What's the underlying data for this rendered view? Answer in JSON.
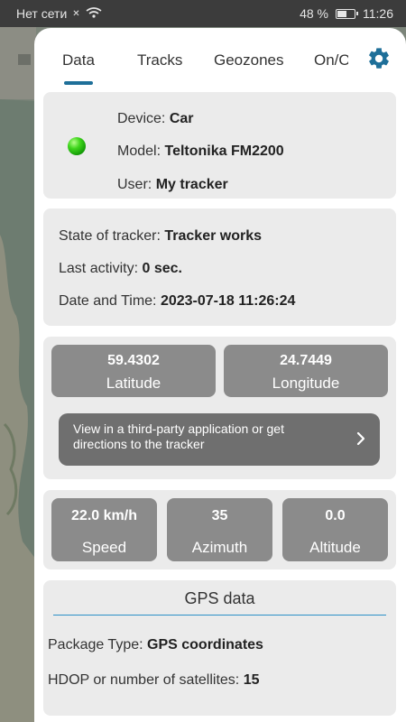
{
  "status_bar": {
    "carrier": "Нет сети",
    "battery": "48 %",
    "battery_level": 0.48,
    "time": "11:26"
  },
  "tabs": [
    {
      "label": "Data",
      "active": true
    },
    {
      "label": "Tracks",
      "active": false
    },
    {
      "label": "Geozones",
      "active": false
    },
    {
      "label": "On/O",
      "active": false
    }
  ],
  "icons": {
    "settings": "gear-icon",
    "direction": "chevron-right-icon",
    "status": "green-status-dot-icon"
  },
  "colors": {
    "accent": "#1e6f99",
    "card_bg": "#ebebeb",
    "tile_bg": "#8b8b8b",
    "status_green": "#2ec21b"
  },
  "device_card": {
    "device_label": "Device:",
    "device_value": "Car",
    "model_label": "Model:",
    "model_value": "Teltonika FM2200",
    "user_label": "User:",
    "user_value": "My tracker"
  },
  "state_card": {
    "state_label": "State of tracker:",
    "state_value": "Tracker works",
    "activity_label": "Last activity:",
    "activity_value": "0 sec.",
    "datetime_label": "Date and Time:",
    "datetime_value": "2023-07-18 11:26:24"
  },
  "coords_card": {
    "latitude_value": "59.4302",
    "latitude_label": "Latitude",
    "longitude_value": "24.7449",
    "longitude_label": "Longitude",
    "directions_button": "View in a third-party application or get directions to the tracker"
  },
  "motion_card": {
    "speed_value": "22.0 km/h",
    "speed_label": "Speed",
    "azimuth_value": "35",
    "azimuth_label": "Azimuth",
    "altitude_value": "0.0",
    "altitude_label": "Altitude"
  },
  "gps_card": {
    "title": "GPS data",
    "package_label": "Package Type:",
    "package_value": "GPS coordinates",
    "hdop_label": "HDOP or number of satellites:",
    "hdop_value": "15"
  }
}
